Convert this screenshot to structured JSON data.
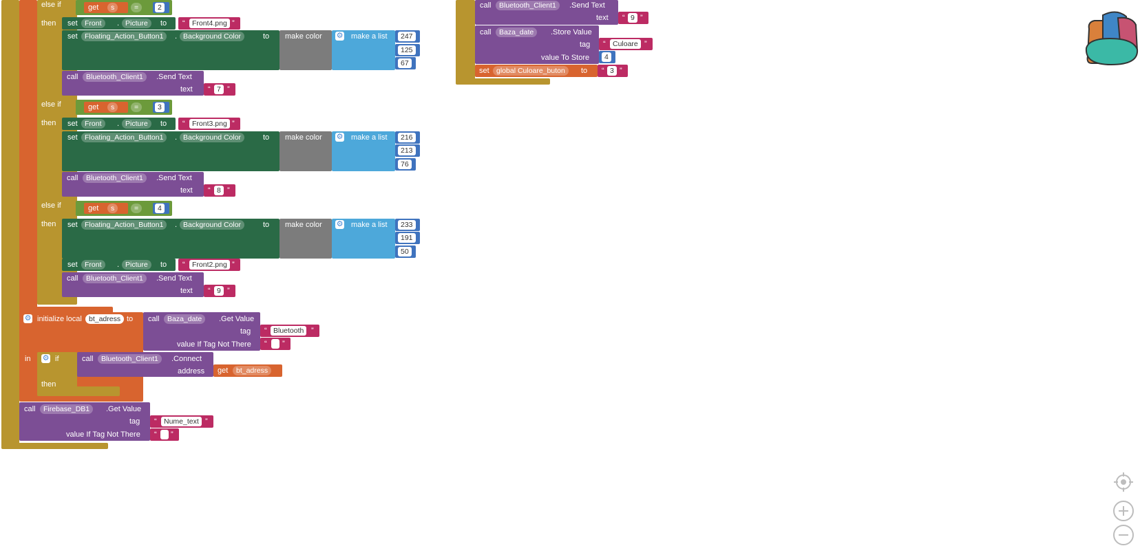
{
  "colors": {
    "control": "#B8952F",
    "variable": "#D8642F",
    "setter": "#2A6A46",
    "call": "#7C4E95",
    "text": "#BC2B63",
    "color": "#7C7C7C",
    "list": "#4DA8DA",
    "math": "#3F73BE",
    "logic": "#6C9A3B"
  },
  "kw": {
    "else_if": "else if",
    "then": "then",
    "get": "get",
    "set": "set",
    "to": "to",
    "call": "call",
    "text": "text",
    "make_color": "make color",
    "make_a_list": "make a list",
    "eq": "=",
    "dot": ".",
    "initialize_local": "initialize local",
    "in": "in",
    "if": "if",
    "tag": "tag",
    "value_if_not_there": "value If Tag Not There",
    "address": "address",
    "value_to_store": "value To Store",
    "quote": "“",
    "endquote": "”"
  },
  "branches": [
    {
      "var": "s",
      "compare": "2",
      "picture_component": "Front",
      "picture_prop": "Picture",
      "picture_file": "Front4.png",
      "fab_component": "Floating_Action_Button1",
      "fab_prop": "Background Color",
      "rgb": [
        "247",
        "125",
        "67"
      ],
      "send_component": "Bluetooth_Client1",
      "send_method": ".Send Text",
      "send_text": "7"
    },
    {
      "var": "s",
      "compare": "3",
      "picture_component": "Front",
      "picture_prop": "Picture",
      "picture_file": "Front3.png",
      "fab_component": "Floating_Action_Button1",
      "fab_prop": "Background Color",
      "rgb": [
        "216",
        "213",
        "76"
      ],
      "send_component": "Bluetooth_Client1",
      "send_method": ".Send Text",
      "send_text": "8"
    },
    {
      "var": "s",
      "compare": "4",
      "picture_component": "Front",
      "picture_prop": "Picture",
      "picture_file": "Front2.png",
      "fab_component": "Floating_Action_Button1",
      "fab_prop": "Background Color",
      "rgb": [
        "233",
        "191",
        "50"
      ],
      "send_component": "Bluetooth_Client1",
      "send_method": ".Send Text",
      "send_text": "9"
    }
  ],
  "init_local": {
    "name": "bt_adress",
    "component": "Baza_date",
    "method": ".Get Value",
    "tag": "Bluetooth",
    "default": ""
  },
  "connect": {
    "component": "Bluetooth_Client1",
    "method": ".Connect",
    "var": "bt_adress"
  },
  "firebase": {
    "component": "Firebase_DB1",
    "method": ".Get Value",
    "tag": "Nume_text",
    "default": ""
  },
  "right_block": {
    "send_component": "Bluetooth_Client1",
    "send_method": ".Send Text",
    "send_text": "9",
    "store_component": "Baza_date",
    "store_method": ".Store Value",
    "store_tag": "Culoare",
    "store_value": "4",
    "global_var": "global Culoare_buton",
    "global_value": "3"
  }
}
